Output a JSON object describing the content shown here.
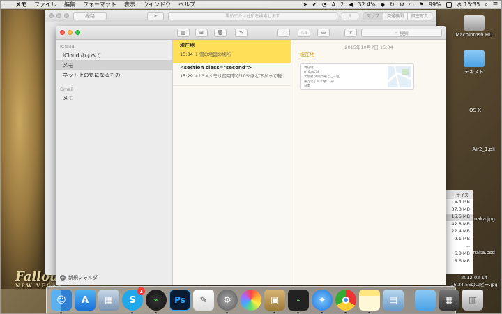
{
  "menubar": {
    "app_name": "メモ",
    "items": [
      "ファイル",
      "編集",
      "フォーマット",
      "表示",
      "ウインドウ",
      "ヘルプ"
    ],
    "status": {
      "adobe_count": "2",
      "volume_percent": "32.4%",
      "battery_percent": "99%",
      "clock": "水 15:35"
    }
  },
  "maps": {
    "back_label": "経路",
    "search_placeholder": "場所または住所を検索します",
    "segments": [
      "マップ",
      "交通機関",
      "航空写真"
    ]
  },
  "notes": {
    "search_placeholder": "検索",
    "sidebar": {
      "groups": [
        {
          "name": "iCloud",
          "items": [
            "iCloud のすべて",
            "メモ",
            "ネット上の気になるもの"
          ],
          "selected_index": 1
        },
        {
          "name": "Gmail",
          "items": [
            "メモ"
          ]
        }
      ],
      "new_folder_label": "新規フォルダ"
    },
    "list": [
      {
        "title": "現在地",
        "time": "15:34",
        "preview": "1 個の地図の場所",
        "selected": true
      },
      {
        "title": "<section class=\"second\">",
        "time": "15:29",
        "preview": "<h3>メモリ使用率が10%ほど下がって軽…",
        "selected": false
      }
    ],
    "editor": {
      "date": "2015年10月7日 15:34",
      "heading": "現在地",
      "map_card_lines": [
        "現在地",
        "919-0634",
        "大阪府 大阪市東とご三区",
        "東淀公丁目10番12号",
        "日本"
      ]
    }
  },
  "desktop": {
    "icons": [
      "Machintosh HD",
      "テキスト",
      "OS X",
      "Air2_1.pli",
      "naka.jpg",
      "naka.psd",
      "2012-02-14",
      "16.34.56のコピー.jpg"
    ],
    "finder_header": "サイズ",
    "finder_sizes": [
      "6.4 MB",
      "37.3 MB",
      "15.5 MB",
      "42.8 MB",
      "22.4 MB",
      "9.1 MB",
      "--",
      "6.8 MB",
      "5.6 MB"
    ]
  },
  "dock": {
    "skype_badge": "1",
    "photoshop_label": "Ps",
    "apps": [
      "finder",
      "app-store",
      "preview",
      "skype",
      "activity-monitor",
      "photoshop",
      "textedit",
      "system-preferences",
      "photos",
      "archive-utility",
      "terminal",
      "safari",
      "chrome",
      "notes",
      "image-capture",
      "folder",
      "downloads",
      "trash"
    ]
  },
  "wallpaper": {
    "logo": "Fallout",
    "logo_sub": "NEW VEGAS"
  },
  "colors": {
    "selected_note": "#ffdf58",
    "accent_heading": "#d39b18",
    "tr_red": "#fc605c",
    "tr_yellow": "#fdbc40",
    "tr_green": "#34c84a"
  }
}
